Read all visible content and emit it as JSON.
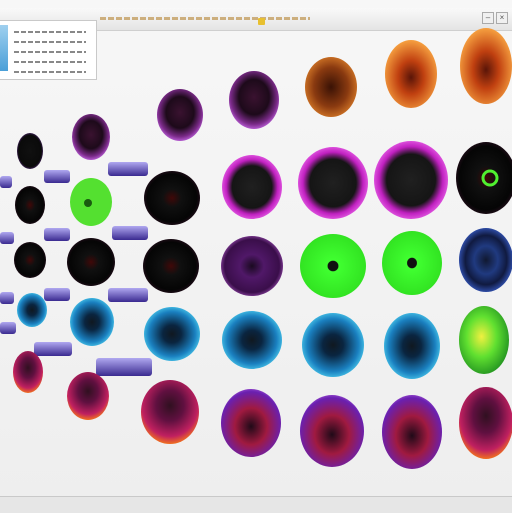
{
  "window": {
    "title": "",
    "accent_color": "#b07a20"
  },
  "titlebar_icons": [
    "minimize-icon",
    "close-icon"
  ],
  "panel": {
    "accent_color": "#4a9fd8",
    "rows": [
      "",
      "",
      "",
      "",
      ""
    ]
  },
  "thumbnail_icon": "eye-icon"
}
